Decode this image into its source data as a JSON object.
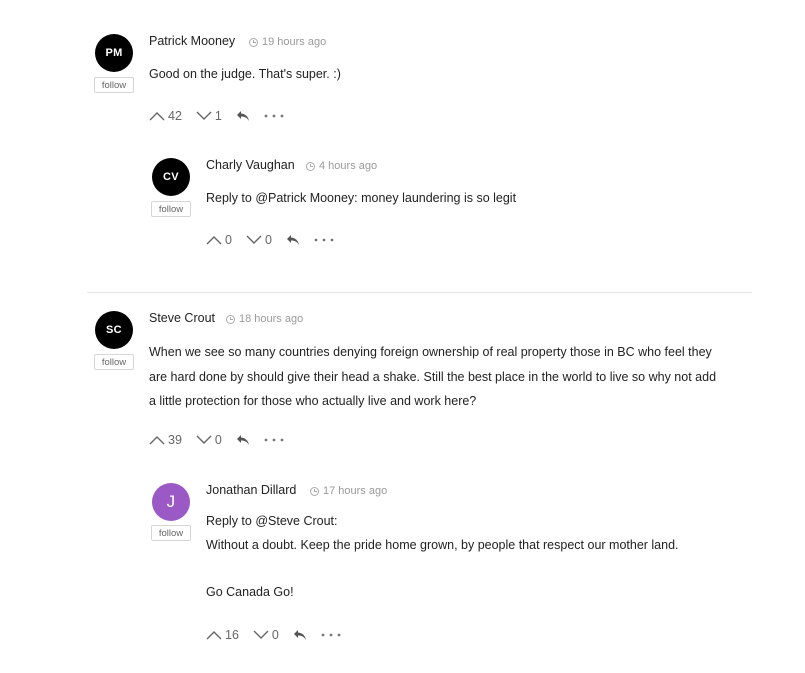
{
  "follow_label": "follow",
  "comments": [
    {
      "initials": "PM",
      "author": "Patrick Mooney",
      "time": "19 hours ago",
      "lines": [
        "Good on the judge. That's super. :)"
      ],
      "upvotes": "42",
      "downvotes": "1"
    },
    {
      "initials": "CV",
      "author": "Charly Vaughan",
      "time": "4 hours ago",
      "lines": [
        "Reply to @Patrick Mooney: money laundering is so legit"
      ],
      "upvotes": "0",
      "downvotes": "0"
    },
    {
      "initials": "SC",
      "author": "Steve Crout",
      "time": "18 hours ago",
      "lines": [
        "When we see so many countries denying foreign ownership of real property those in BC who feel they",
        "are hard done by should give their head a shake. Still the best place in the world to live so why not add",
        "a little protection for those who actually live and work here?"
      ],
      "upvotes": "39",
      "downvotes": "0"
    },
    {
      "initials": "J",
      "author": "Jonathan Dillard",
      "time": "17 hours ago",
      "lines": [
        "Reply to @Steve Crout:",
        "Without a doubt. Keep the pride home grown, by people that respect our mother land.",
        "",
        "Go Canada Go!"
      ],
      "upvotes": "16",
      "downvotes": "0"
    }
  ]
}
